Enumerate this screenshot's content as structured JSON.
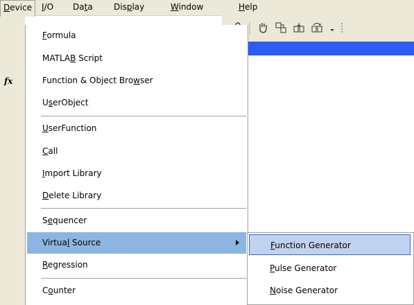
{
  "menubar": [
    {
      "label": "Device",
      "accel": "D",
      "rest": "evice",
      "pre": ""
    },
    {
      "label": "I/O",
      "pre": "",
      "accel": "I",
      "rest": "/O"
    },
    {
      "label": "Data",
      "pre": "Da",
      "accel": "t",
      "rest": "a"
    },
    {
      "label": "Display",
      "pre": "Dis",
      "accel": "p",
      "rest": "lay"
    },
    {
      "label": "Window",
      "pre": "",
      "accel": "W",
      "rest": "indow"
    },
    {
      "label": "Help",
      "pre": "",
      "accel": "H",
      "rest": "elp"
    }
  ],
  "device_menu": [
    {
      "pre": "",
      "accel": "F",
      "rest": "ormula"
    },
    {
      "pre": "MATLA",
      "accel": "B",
      "rest": " Script"
    },
    {
      "pre": "Function & Object Bro",
      "accel": "w",
      "rest": "ser"
    },
    {
      "pre": "U",
      "accel": "s",
      "rest": "erObject"
    },
    {
      "pre": "",
      "accel": "U",
      "rest": "serFunction"
    },
    {
      "pre": "",
      "accel": "C",
      "rest": "all"
    },
    {
      "pre": "",
      "accel": "I",
      "rest": "mport Library"
    },
    {
      "pre": "",
      "accel": "D",
      "rest": "elete Library"
    },
    {
      "pre": "S",
      "accel": "e",
      "rest": "quencer"
    },
    {
      "pre": "Virtua",
      "accel": "l",
      "rest": " Source"
    },
    {
      "pre": "",
      "accel": "R",
      "rest": "egression"
    },
    {
      "pre": "C",
      "accel": "o",
      "rest": "unter"
    }
  ],
  "virtual_source_submenu": [
    {
      "pre": "",
      "accel": "F",
      "rest": "unction Generator"
    },
    {
      "pre": "",
      "accel": "P",
      "rest": "ulse Generator"
    },
    {
      "pre": "",
      "accel": "N",
      "rest": "oise Generator"
    }
  ],
  "icons": {
    "fx": "fx",
    "toolbar": [
      "unlock-icon",
      "hand-icon",
      "connect-icon",
      "step-into-icon",
      "step-over-icon"
    ]
  },
  "colors": {
    "menu_highlight": "#8db5e2",
    "submenu_highlight": "#c1d2ee",
    "title_bar": "#2d5bf5",
    "chrome": "#ece9d8"
  }
}
